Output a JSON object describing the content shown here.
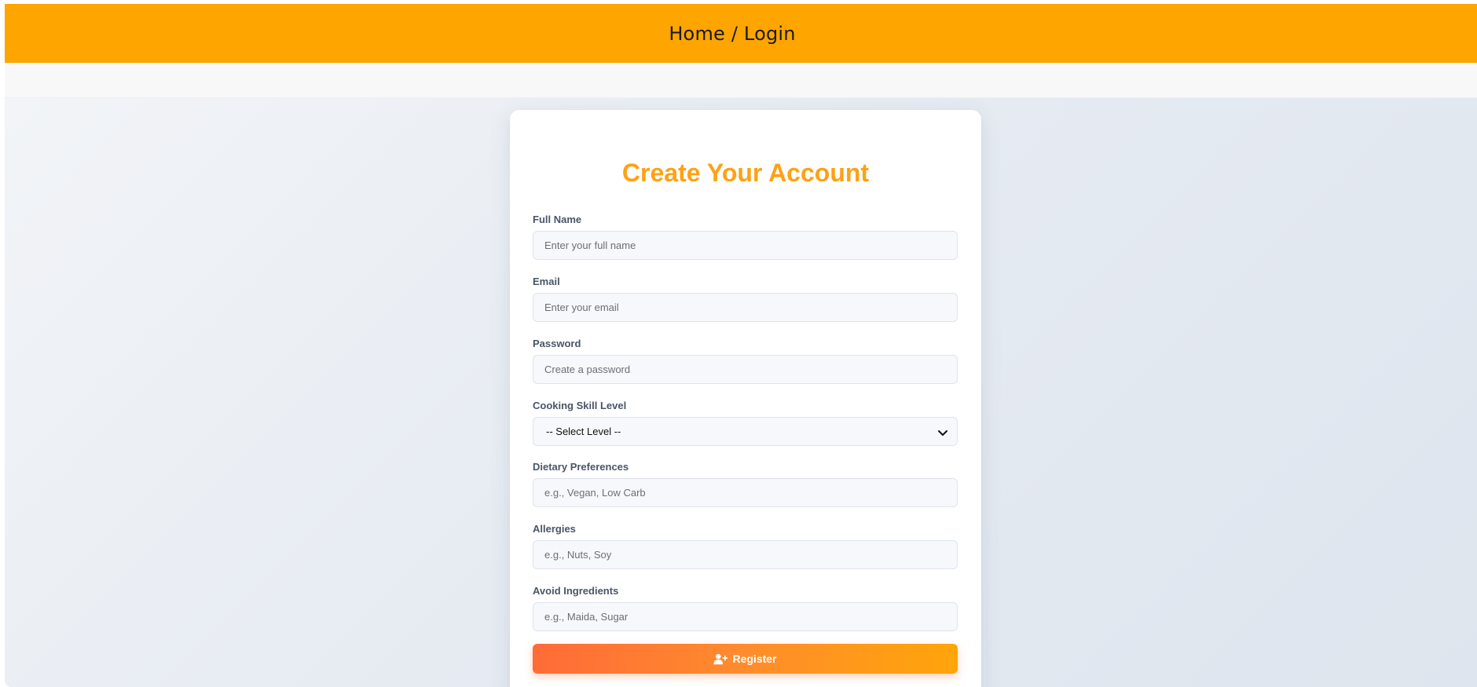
{
  "header": {
    "breadcrumb": "Home / Login",
    "color": "#ffa500"
  },
  "form": {
    "title": "Create Your Account",
    "title_color": "#ffa114",
    "fields": [
      {
        "label": "Full Name",
        "placeholder": "Enter your full name"
      },
      {
        "label": "Email",
        "placeholder": "Enter your email"
      },
      {
        "label": "Password",
        "placeholder": "Create a password"
      },
      {
        "label": "Cooking Skill Level",
        "selected": "-- Select Level --"
      },
      {
        "label": "Dietary Preferences",
        "placeholder": "e.g., Vegan, Low Carb"
      },
      {
        "label": "Allergies",
        "placeholder": "e.g., Nuts, Soy"
      },
      {
        "label": "Avoid Ingredients",
        "placeholder": "e.g., Maida, Sugar"
      }
    ],
    "submit": {
      "label": "Register",
      "icon": "user-plus-icon",
      "gradient": [
        "#ff6b38",
        "#ffa50a"
      ]
    }
  }
}
